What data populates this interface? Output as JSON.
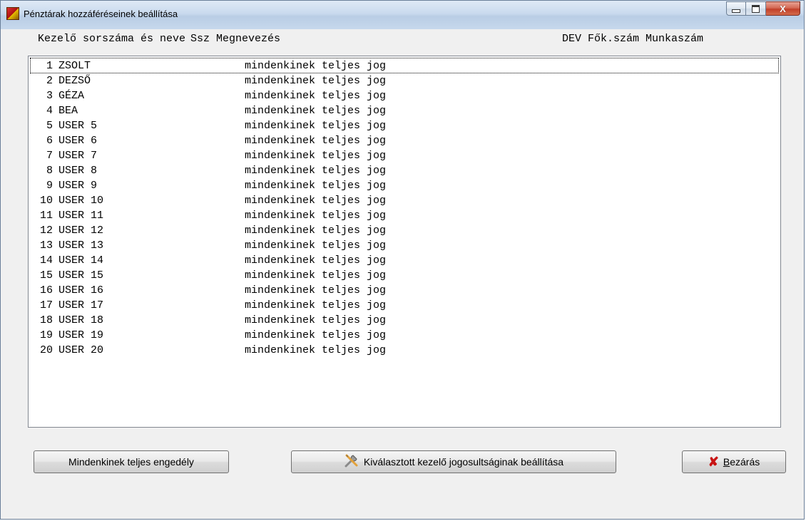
{
  "window": {
    "title": "Pénztárak hozzáféréseinek beállítása",
    "caption_buttons": {
      "minimize": "minimize",
      "maximize": "maximize",
      "close": "X"
    }
  },
  "header": {
    "col1": "Kezelő sorszáma és neve",
    "col2": "Ssz Megnevezés",
    "col3": "DEV Fők.szám Munkaszám"
  },
  "rows": [
    {
      "num": "1",
      "name": "ZSOLT",
      "right": "mindenkinek teljes jog"
    },
    {
      "num": "2",
      "name": "DEZSŐ",
      "right": "mindenkinek teljes jog"
    },
    {
      "num": "3",
      "name": "GÉZA",
      "right": "mindenkinek teljes jog"
    },
    {
      "num": "4",
      "name": "BEA",
      "right": "mindenkinek teljes jog"
    },
    {
      "num": "5",
      "name": "USER 5",
      "right": "mindenkinek teljes jog"
    },
    {
      "num": "6",
      "name": "USER 6",
      "right": "mindenkinek teljes jog"
    },
    {
      "num": "7",
      "name": "USER 7",
      "right": "mindenkinek teljes jog"
    },
    {
      "num": "8",
      "name": "USER 8",
      "right": "mindenkinek teljes jog"
    },
    {
      "num": "9",
      "name": "USER 9",
      "right": "mindenkinek teljes jog"
    },
    {
      "num": "10",
      "name": "USER 10",
      "right": "mindenkinek teljes jog"
    },
    {
      "num": "11",
      "name": "USER 11",
      "right": "mindenkinek teljes jog"
    },
    {
      "num": "12",
      "name": "USER 12",
      "right": "mindenkinek teljes jog"
    },
    {
      "num": "13",
      "name": "USER 13",
      "right": "mindenkinek teljes jog"
    },
    {
      "num": "14",
      "name": "USER 14",
      "right": "mindenkinek teljes jog"
    },
    {
      "num": "15",
      "name": "USER 15",
      "right": "mindenkinek teljes jog"
    },
    {
      "num": "16",
      "name": "USER 16",
      "right": "mindenkinek teljes jog"
    },
    {
      "num": "17",
      "name": "USER 17",
      "right": "mindenkinek teljes jog"
    },
    {
      "num": "18",
      "name": "USER 18",
      "right": "mindenkinek teljes jog"
    },
    {
      "num": "19",
      "name": "USER 19",
      "right": "mindenkinek teljes jog"
    },
    {
      "num": "20",
      "name": "USER 20",
      "right": "mindenkinek teljes jog"
    }
  ],
  "buttons": {
    "all_rights": "Mindenkinek teljes engedély",
    "set_selected": "Kiválasztott kezelő jogosultságinak beállítása",
    "close_prefix": "B",
    "close_rest": "ezárás"
  },
  "icons": {
    "app": "cash-register-icon",
    "tools": "tools-icon",
    "close": "red-x-icon"
  }
}
